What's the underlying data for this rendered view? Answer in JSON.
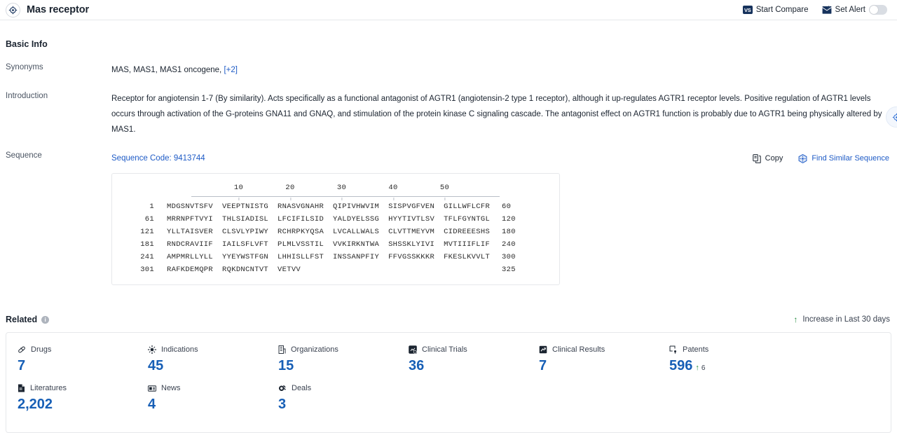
{
  "header": {
    "icon": "target-icon",
    "title": "Mas receptor",
    "start_compare": "Start Compare",
    "vs_badge": "VS",
    "set_alert": "Set Alert",
    "alert_toggle_on": false
  },
  "basic_info": {
    "section_title": "Basic Info",
    "synonyms_label": "Synonyms",
    "synonyms_value": "MAS,  MAS1,  MAS1 oncogene,",
    "synonyms_more": "[+2]",
    "introduction_label": "Introduction",
    "introduction_value": "Receptor for angiotensin 1-7 (By similarity). Acts specifically as a functional antagonist of AGTR1 (angiotensin-2 type 1 receptor), although it up-regulates AGTR1 receptor levels. Positive regulation of AGTR1 levels occurs through activation of the G-proteins GNA11 and GNAQ, and stimulation of the protein kinase C signaling cascade. The antagonist effect on AGTR1 function is probably due to AGTR1 being physically altered by MAS1."
  },
  "sequence": {
    "label": "Sequence",
    "code_text": "Sequence Code: 9413744",
    "copy_label": "Copy",
    "find_similar_label": "Find Similar Sequence",
    "ruler_ticks": [
      "10",
      "20",
      "30",
      "40",
      "50"
    ],
    "lines": [
      {
        "start": "1",
        "chunks": [
          "MDGSNVTSFV",
          "VEEPTNISTG",
          "RNASVGNAHR",
          "QIPIVHWVIM",
          "SISPVGFVEN",
          "GILLWFLCFR"
        ],
        "end": "60"
      },
      {
        "start": "61",
        "chunks": [
          "MRRNPFTVYI",
          "THLSIADISL",
          "LFCIFILSID",
          "YALDYELSSG",
          "HYYTIVTLSV",
          "TFLFGYNTGL"
        ],
        "end": "120"
      },
      {
        "start": "121",
        "chunks": [
          "YLLTAISVER",
          "CLSVLYPIWY",
          "RCHRPKYQSA",
          "LVCALLWALS",
          "CLVTTMEYVM",
          "CIDREEESHS"
        ],
        "end": "180"
      },
      {
        "start": "181",
        "chunks": [
          "RNDCRAVIIF",
          "IAILSFLVFT",
          "PLMLVSSTIL",
          "VVKIRKNTWA",
          "SHSSKLYIVI",
          "MVTIIIFLIF"
        ],
        "end": "240"
      },
      {
        "start": "241",
        "chunks": [
          "AMPMRLLYLL",
          "YYEYWSTFGN",
          "LHHISLLFST",
          "INSSANPFIY",
          "FFVGSSKKKR",
          "FKESLKVVLT"
        ],
        "end": "300"
      },
      {
        "start": "301",
        "chunks": [
          "RAFKDEMQPR",
          "RQKDNCNTVT",
          "VETVV"
        ],
        "end": "325"
      }
    ]
  },
  "related": {
    "title": "Related",
    "info_glyph": "i",
    "increase_note": "Increase in Last 30 days",
    "arrow_glyph": "↑",
    "cards": [
      {
        "icon": "capsule-icon",
        "label": "Drugs",
        "value": "7",
        "delta": ""
      },
      {
        "icon": "virus-icon",
        "label": "Indications",
        "value": "45",
        "delta": ""
      },
      {
        "icon": "building-icon",
        "label": "Organizations",
        "value": "15",
        "delta": ""
      },
      {
        "icon": "clinical-trial-icon",
        "label": "Clinical Trials",
        "value": "36",
        "delta": ""
      },
      {
        "icon": "clinical-result-icon",
        "label": "Clinical Results",
        "value": "7",
        "delta": ""
      },
      {
        "icon": "patent-icon",
        "label": "Patents",
        "value": "596",
        "delta": "6"
      },
      {
        "icon": "literature-icon",
        "label": "Literatures",
        "value": "2,202",
        "delta": ""
      },
      {
        "icon": "news-icon",
        "label": "News",
        "value": "4",
        "delta": ""
      },
      {
        "icon": "deal-icon",
        "label": "Deals",
        "value": "3",
        "delta": ""
      }
    ]
  },
  "side_fab": {
    "icon": "target-icon"
  },
  "colors": {
    "link": "#1e5bc6",
    "value": "#175fb6",
    "accent_dark": "#16325c",
    "increase_green": "#1f8a3b",
    "border": "#e6e8eb"
  }
}
